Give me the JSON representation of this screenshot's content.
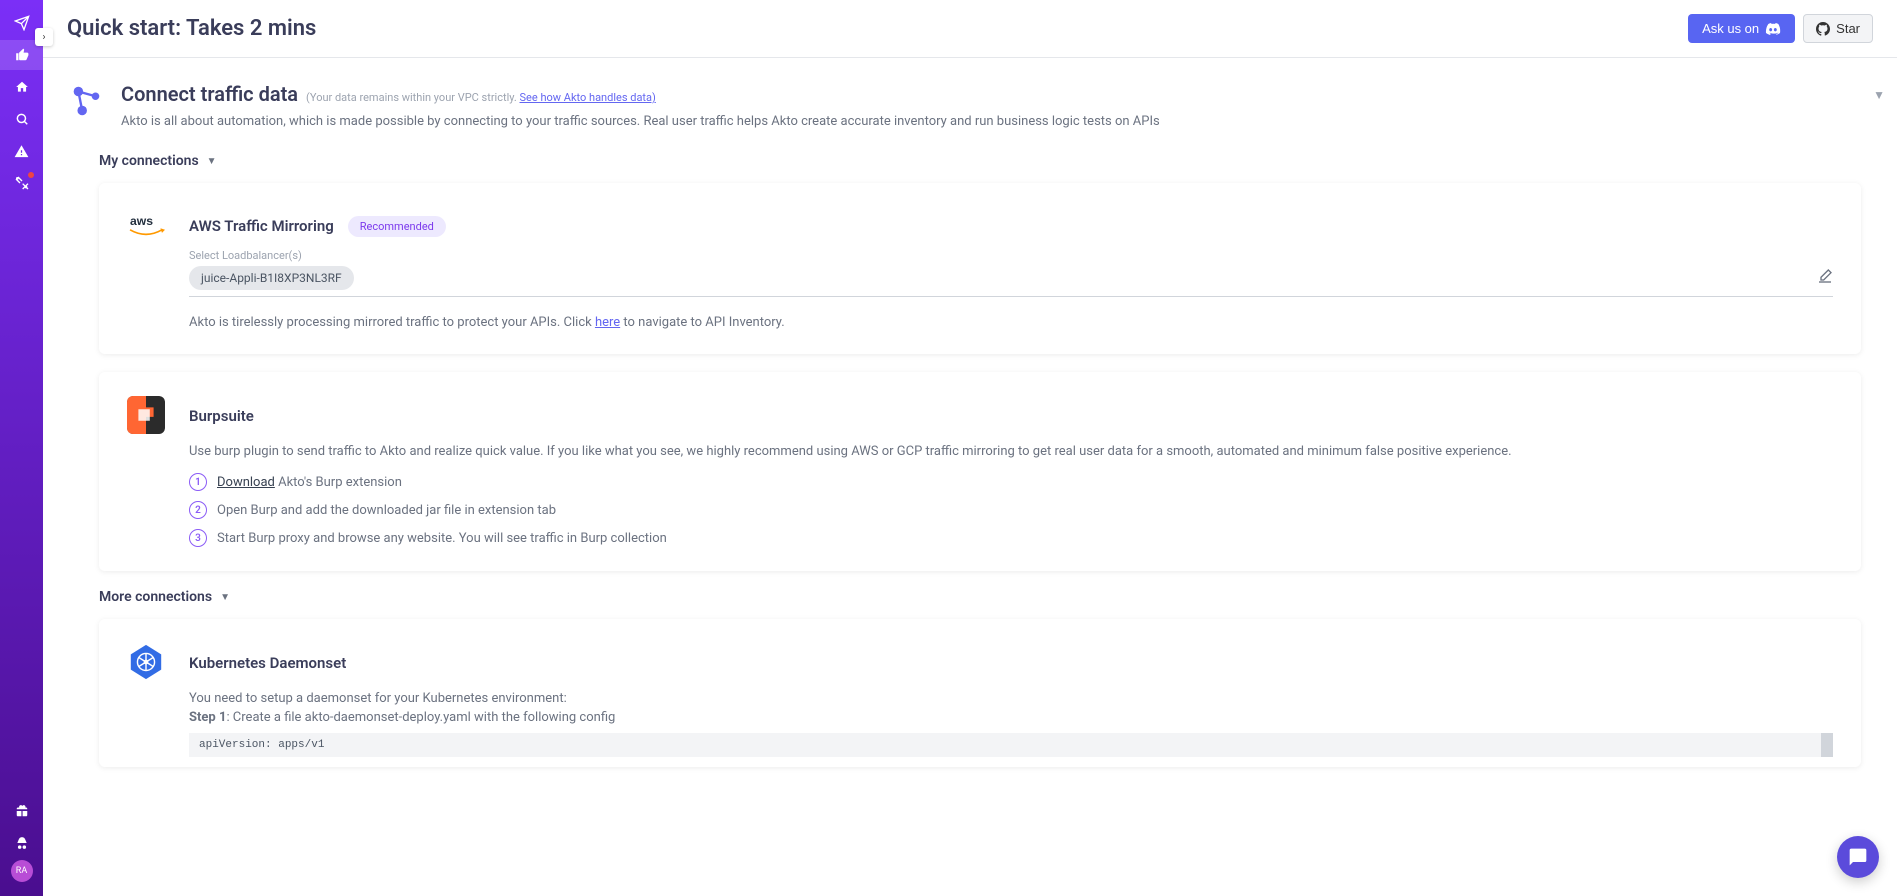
{
  "header": {
    "title": "Quick start: Takes 2 mins",
    "discord_label": "Ask us on",
    "star_label": "Star"
  },
  "sidebar": {
    "avatar_initials": "RA",
    "expand_glyph": "›"
  },
  "section": {
    "title": "Connect traffic data",
    "inline_note_prefix": "(Your data remains within your VPC strictly. ",
    "inline_link": "See how Akto handles data)",
    "description": "Akto is all about automation, which is made possible by connecting to your traffic sources. Real user traffic helps Akto create accurate inventory and run business logic tests on APIs"
  },
  "my_connections_label": "My connections",
  "more_connections_label": "More connections",
  "aws": {
    "title": "AWS Traffic Mirroring",
    "badge": "Recommended",
    "field_label": "Select Loadbalancer(s)",
    "chip": "juice-Appli-B1I8XP3NL3RF",
    "info_prefix": "Akto is tirelessly processing mirrored traffic to protect your APIs. Click ",
    "info_link": "here",
    "info_suffix": " to navigate to API Inventory."
  },
  "burp": {
    "title": "Burpsuite",
    "desc": "Use burp plugin to send traffic to Akto and realize quick value. If you like what you see, we highly recommend using AWS or GCP traffic mirroring to get real user data for a smooth, automated and minimum false positive experience.",
    "step1_link": "Download",
    "step1_rest": " Akto's Burp extension",
    "step2": "Open Burp and add the downloaded jar file in extension tab",
    "step3": "Start Burp proxy and browse any website. You will see traffic in Burp collection"
  },
  "k8s": {
    "title": "Kubernetes Daemonset",
    "desc": "You need to setup a daemonset for your Kubernetes environment:",
    "step1_prefix": "Step 1",
    "step1_rest": ": Create a file akto-daemonset-deploy.yaml with the following config",
    "code": "apiVersion: apps/v1"
  }
}
